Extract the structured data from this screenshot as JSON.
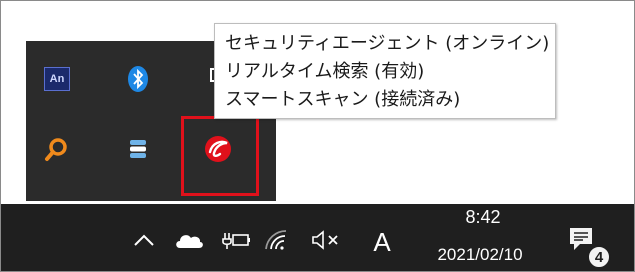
{
  "tooltip": {
    "lines": [
      "セキュリティエージェント (オンライン)",
      "リアルタイム検索 (有効)",
      "スマートスキャン (接続済み)"
    ]
  },
  "overflow_icons": [
    {
      "name": "an-app-icon",
      "label": "An"
    },
    {
      "name": "bluetooth-icon"
    },
    {
      "name": "usb-device-icon"
    },
    {
      "name": "search-magnifier-icon"
    },
    {
      "name": "database-icon"
    },
    {
      "name": "security-agent-icon"
    }
  ],
  "taskbar": {
    "ime_label": "A",
    "time": "8:42",
    "date": "2021/02/10",
    "notification_count": "4",
    "icons": [
      "chevron-up-icon",
      "onedrive-cloud-icon",
      "battery-plug-icon",
      "wifi-icon",
      "volume-muted-icon",
      "notification-icon"
    ]
  },
  "colors": {
    "panel_bg": "#2b2b2b",
    "taskbar_bg": "#1f1f1f",
    "highlight": "#e0111b",
    "security_red": "#e0111b",
    "bluetooth_blue": "#1e88e5",
    "search_orange": "#f08a1c"
  }
}
